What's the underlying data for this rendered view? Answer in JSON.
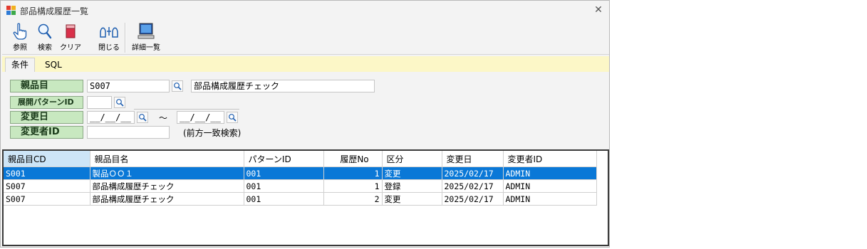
{
  "window": {
    "title": "部品構成履歴一覧",
    "close": "✕"
  },
  "toolbar": {
    "ref_label": "参照",
    "search_label": "検索",
    "clear_label": "クリア",
    "close_label": "閉じる",
    "detail_label": "詳細一覧"
  },
  "tabs": [
    {
      "label": "条件"
    },
    {
      "label": "SQL"
    }
  ],
  "form": {
    "parent_item_label": "親品目",
    "parent_item_code": "S007",
    "parent_item_name": "部品構成履歴チェック",
    "pattern_label": "展開パターンID",
    "pattern_value": "",
    "change_date_label": "変更日",
    "date_from": "__/__/__",
    "tilde": "～",
    "date_to": "__/__/__",
    "changer_label": "変更者ID",
    "changer_value": "",
    "changer_hint": "(前方一致検索)"
  },
  "grid": {
    "headers": [
      "親品目CD",
      "親品目名",
      "パターンID",
      "履歴No",
      "区分",
      "変更日",
      "変更者ID"
    ],
    "rows": [
      [
        "S001",
        "製品ＯＯ１",
        "001",
        "1",
        "変更",
        "2025/02/17",
        "ADMIN"
      ],
      [
        "S007",
        "部品構成履歴チェック",
        "001",
        "1",
        "登録",
        "2025/02/17",
        "ADMIN"
      ],
      [
        "S007",
        "部品構成履歴チェック",
        "001",
        "2",
        "変更",
        "2025/02/17",
        "ADMIN"
      ]
    ]
  }
}
